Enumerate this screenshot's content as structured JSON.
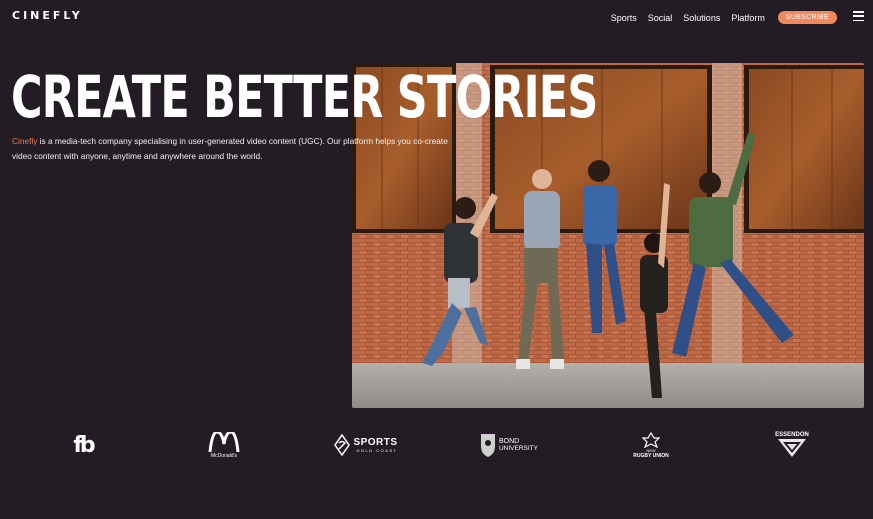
{
  "nav": {
    "logo": "CINEFLY",
    "items": [
      "Sports",
      "Social",
      "Solutions",
      "Platform"
    ],
    "subscribe": "SUBSCRIBE"
  },
  "hero": {
    "headline": "CREATE BETTER STORIES",
    "brand": "Cinefly",
    "description": " is a media-tech company specialising in user-generated video content (UGC). Our platform helps you co-create video content with anyone, anytime and anywhere around the world.",
    "image": "photo of five friends jumping in front of a rusty brick wall"
  },
  "partners": [
    {
      "name": "fb-logo",
      "text": "fb"
    },
    {
      "name": "mcdonalds-logo",
      "text": "McDonald's"
    },
    {
      "name": "sports-gold-coast-logo",
      "text": "SPORTS",
      "sub": "GOLD COAST"
    },
    {
      "name": "bond-university-logo",
      "text": "BOND",
      "sub": "UNIVERSITY"
    },
    {
      "name": "new-rugby-union-logo",
      "text": "NEW",
      "sub": "RUGBY UNION"
    },
    {
      "name": "essendon-logo",
      "text": "ESSENDON"
    }
  ],
  "colors": {
    "background": "#231c24",
    "accent": "#f08a5d"
  }
}
